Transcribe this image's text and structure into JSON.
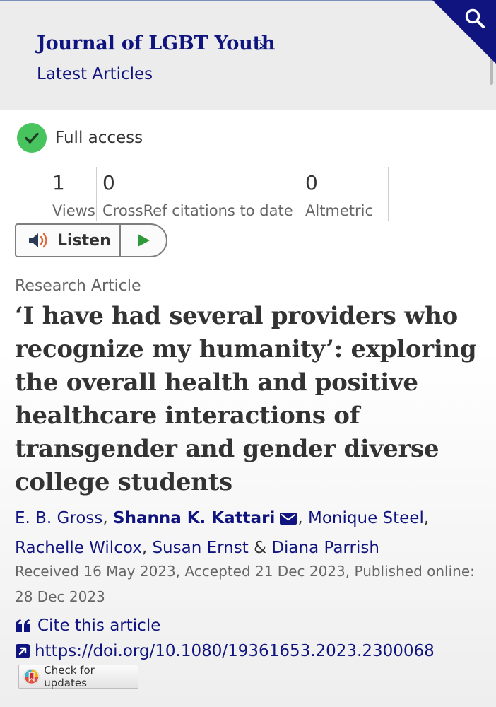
{
  "header": {
    "journal_title": "Journal of LGBT Youth",
    "chevron": "›",
    "latest_label": "Latest Articles",
    "search_icon": "search-icon",
    "accent_color": "#10147e"
  },
  "access": {
    "label": "Full access",
    "icon": "check-circle-icon",
    "icon_color": "#48c45e"
  },
  "metrics": [
    {
      "value": "1",
      "label": "Views"
    },
    {
      "value": "0",
      "label": "CrossRef citations to date"
    },
    {
      "value": "0",
      "label": "Altmetric"
    }
  ],
  "listen": {
    "label": "Listen",
    "speaker_icon": "speaker-icon",
    "play_icon": "play-icon"
  },
  "article": {
    "type": "Research Article",
    "title": "‘I have had several providers who recognize my humanity’: exploring the overall health and positive healthcare interactions of transgender and gender diverse college students",
    "authors": [
      {
        "name": "E. B. Gross",
        "sep": ", "
      },
      {
        "name": "Shanna K. Kattari",
        "sep": ", "
      },
      {
        "name": "Monique Steel",
        "sep": ","
      },
      {
        "name": "Rachelle Wilcox",
        "sep": ", "
      },
      {
        "name": "Susan Ernst",
        "sep": " & "
      },
      {
        "name": "Diana Parrish",
        "sep": ""
      }
    ],
    "dates": "Received 16 May 2023, Accepted 21 Dec 2023, Published online: 28 Dec 2023"
  },
  "links": {
    "cite_label": "Cite this article",
    "cite_icon": "quote-icon",
    "doi": "https://doi.org/10.1080/19361653.2023.2300068",
    "doi_icon": "external-link-icon"
  },
  "updates": {
    "label": "Check for updates",
    "icon": "crossmark-icon"
  }
}
